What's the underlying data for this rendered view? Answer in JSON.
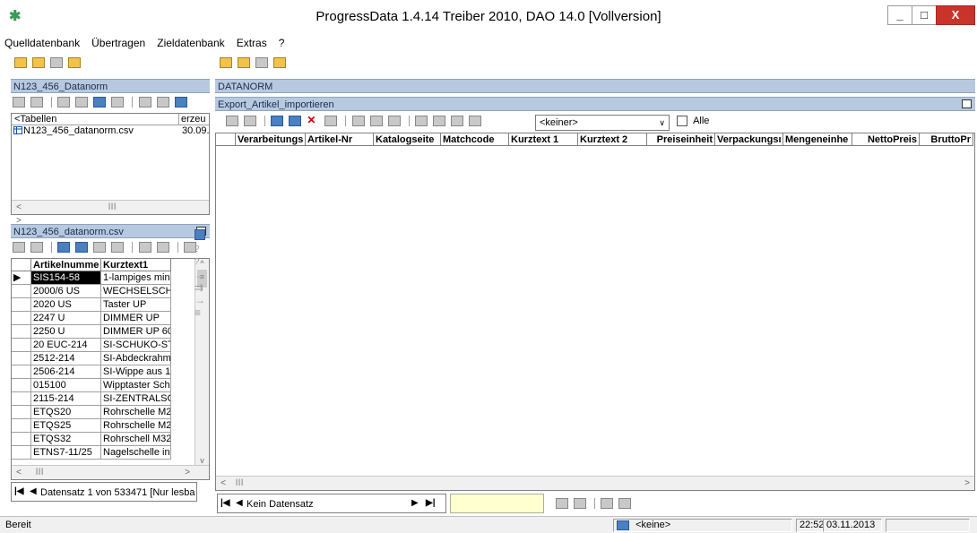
{
  "window": {
    "title": "ProgressData 1.4.14  Treiber 2010, DAO 14.0  [Vollversion]",
    "minimize": "_",
    "maximize": "□",
    "close": "X"
  },
  "menu": {
    "items": [
      "Quelldatenbank",
      "Übertragen",
      "Zieldatenbank",
      "Extras",
      "?"
    ]
  },
  "left_panel": {
    "title": "N123_456_Datanorm",
    "tables_header": "<Tabellen",
    "tables_header2": "erzeu",
    "tables": [
      {
        "name": "N123_456_datanorm.csv",
        "date": "30.09."
      }
    ]
  },
  "table_panel": {
    "title": "N123_456_datanorm.csv",
    "columns": [
      "Artikelnumme",
      "Kurztext1"
    ],
    "rows": [
      [
        "SIS154-58",
        "1-lampiges mini"
      ],
      [
        "2000/6 US",
        "WECHSELSCH"
      ],
      [
        "2020 US",
        "Taster UP"
      ],
      [
        "2247 U",
        "DIMMER UP"
      ],
      [
        "2250 U",
        "DIMMER UP 60"
      ],
      [
        "20 EUC-214",
        "SI-SCHUKO-ST"
      ],
      [
        "2512-214",
        "SI-Abdeckrahm"
      ],
      [
        "2506-214",
        "SI-Wippe aus 1"
      ],
      [
        "015100",
        "Wipptaster Schl"
      ],
      [
        "2115-214",
        "SI-ZENTRALSC"
      ],
      [
        "ETQS20",
        "Rohrschelle M2"
      ],
      [
        "ETQS25",
        "Rohrschelle M2"
      ],
      [
        "ETQS32",
        "Rohrschell M32"
      ],
      [
        "ETNS7-11/25",
        "Nagelschelle in"
      ]
    ],
    "nav_text": "Datensatz 1 von 533471  [Nur lesba"
  },
  "right_panel": {
    "title": "DATANORM",
    "subtitle": "Export_Artikel_importieren",
    "filter_value": "<keiner>",
    "alle_label": "Alle",
    "columns": [
      "Verarbeitungs",
      "Artikel-Nr",
      "Katalogseite",
      "Matchcode",
      "Kurztext 1",
      "Kurztext 2",
      "Preiseinheit",
      "Verpackungsı",
      "Mengeneinhe",
      "NettoPreis",
      "BruttoPr"
    ],
    "nav_text": "Kein Datensatz"
  },
  "status": {
    "text": "Bereit",
    "filter": "<keine>",
    "time": "22:52",
    "date": "03.11.2013"
  }
}
